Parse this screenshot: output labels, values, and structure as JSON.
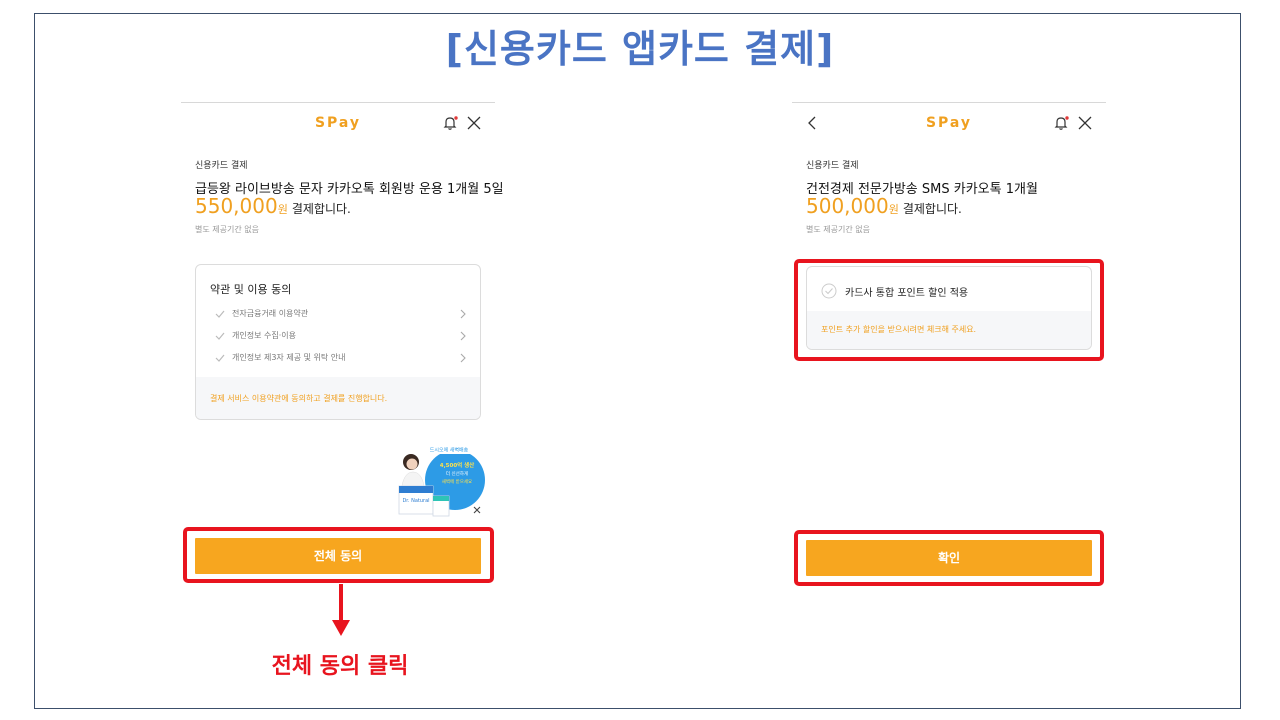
{
  "slide": {
    "title": "[신용카드 앱카드 결제]"
  },
  "colors": {
    "accent": "#f7a61f",
    "highlight": "#e8141e",
    "title": "#4a74c4"
  },
  "left_panel": {
    "logo": "SPay",
    "payment_label": "신용카드 결제",
    "product": "급등왕 라이브방송 문자 카카오톡 회원방 운용 1개월 5일",
    "amount": "550,000",
    "currency": "원",
    "pay_text": "결제합니다.",
    "period": "별도 제공기간 없음",
    "terms": {
      "title": "약관 및 이용 동의",
      "items": [
        {
          "label": "전자금융거래 이용약관"
        },
        {
          "label": "개인정보 수집·이용"
        },
        {
          "label": "개인정보 제3자 제공 및 위탁 안내"
        }
      ],
      "footer": "결제 서비스 이용약관에 동의하고 결제를 진행합니다."
    },
    "ad": {
      "badge": "드시오에 새벽배송",
      "line1": "4,500억 생산",
      "line2": "더 신선하게",
      "line3": "새벽에 받으세요",
      "product_text": "Dr. Natural"
    },
    "button_label": "전체 동의"
  },
  "right_panel": {
    "logo": "SPay",
    "payment_label": "신용카드 결제",
    "product": "건전경제 전문가방송 SMS 카카오톡 1개월",
    "amount": "500,000",
    "currency": "원",
    "pay_text": "결제합니다.",
    "period": "별도 제공기간 없음",
    "point": {
      "label": "카드사 통합 포인트 할인 적용",
      "footer": "포인트 추가 할인을 받으시려면 체크해 주세요."
    },
    "button_label": "확인"
  },
  "annotation": {
    "caption": "전체 동의 클릭"
  }
}
